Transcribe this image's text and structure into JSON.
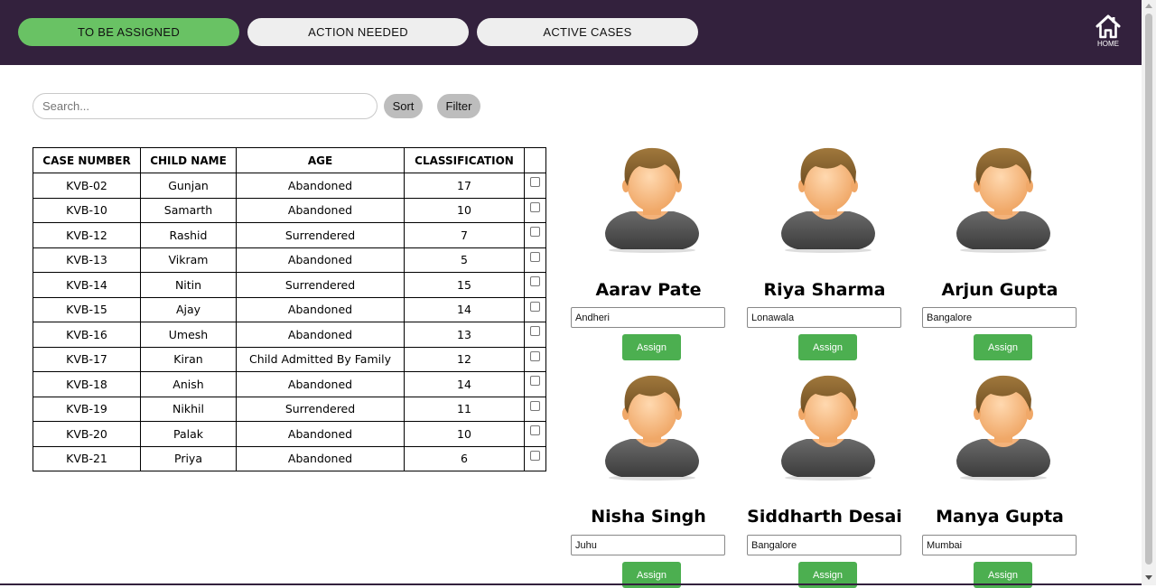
{
  "nav": {
    "tabs": [
      {
        "label": "TO BE ASSIGNED",
        "active": true
      },
      {
        "label": "ACTION NEEDED",
        "active": false
      },
      {
        "label": "ACTIVE CASES",
        "active": false
      }
    ],
    "home_label": "HOME",
    "home_icon": "home-icon"
  },
  "colors": {
    "header_bg": "#33213d",
    "active_tab": "#69c264",
    "assign_button": "#4caf50"
  },
  "toolbar": {
    "search_placeholder": "Search...",
    "sort_label": "Sort",
    "filter_label": "Filter"
  },
  "table": {
    "headers": [
      "CASE NUMBER",
      "CHILD NAME",
      "AGE",
      "CLASSIFICATION"
    ],
    "rows": [
      {
        "case": "KVB-02",
        "name": "Gunjan",
        "age": "Abandoned",
        "classification": "17"
      },
      {
        "case": "KVB-10",
        "name": "Samarth",
        "age": "Abandoned",
        "classification": "10"
      },
      {
        "case": "KVB-12",
        "name": "Rashid",
        "age": "Surrendered",
        "classification": "7"
      },
      {
        "case": "KVB-13",
        "name": "Vikram",
        "age": "Abandoned",
        "classification": "5"
      },
      {
        "case": "KVB-14",
        "name": "Nitin",
        "age": "Surrendered",
        "classification": "15"
      },
      {
        "case": "KVB-15",
        "name": "Ajay",
        "age": "Abandoned",
        "classification": "14"
      },
      {
        "case": "KVB-16",
        "name": "Umesh",
        "age": "Abandoned",
        "classification": "13"
      },
      {
        "case": "KVB-17",
        "name": "Kiran",
        "age": "Child Admitted By Family",
        "classification": "12"
      },
      {
        "case": "KVB-18",
        "name": "Anish",
        "age": "Abandoned",
        "classification": "14"
      },
      {
        "case": "KVB-19",
        "name": "Nikhil",
        "age": "Surrendered",
        "classification": "11"
      },
      {
        "case": "KVB-20",
        "name": "Palak",
        "age": "Abandoned",
        "classification": "10"
      },
      {
        "case": "KVB-21",
        "name": "Priya",
        "age": "Abandoned",
        "classification": "6"
      }
    ]
  },
  "workers": [
    {
      "name": "Aarav Pate",
      "location": "Andheri",
      "button": "Assign"
    },
    {
      "name": "Riya Sharma",
      "location": "Lonawala",
      "button": "Assign"
    },
    {
      "name": "Arjun Gupta",
      "location": "Bangalore",
      "button": "Assign"
    },
    {
      "name": "Nisha Singh",
      "location": "Juhu",
      "button": "Assign"
    },
    {
      "name": "Siddharth Desai",
      "location": "Bangalore",
      "button": "Assign"
    },
    {
      "name": "Manya Gupta",
      "location": "Mumbai",
      "button": "Assign"
    }
  ]
}
